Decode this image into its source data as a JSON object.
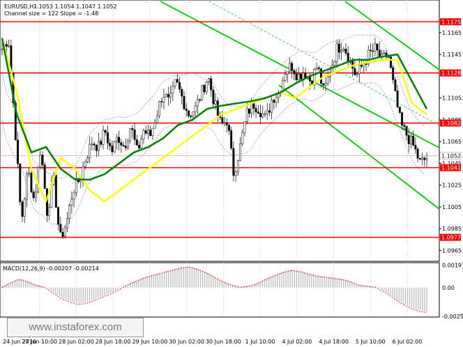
{
  "header": {
    "symbol": "EURUSD,H1",
    "ohlc": "1.1053 1.1054 1.1047 1.1052",
    "channel": "Channel size = 122 Slope = -1.48",
    "macd_label": "MACD(12,26,9) -0.00207 -0.00214"
  },
  "watermark": "www.instaforex.com",
  "chart_data": {
    "type": "line",
    "title": "EURUSD,H1",
    "ylim": [
      1.0955,
      1.1195
    ],
    "y_ticks": [
      "1.1165",
      "1.1145",
      "1.1105",
      "1.1085",
      "1.1065",
      "1.1045",
      "1.1025",
      "1.1005",
      "1.0985",
      "1.0965"
    ],
    "x_labels": [
      "24 Jun 2016",
      "27 Jun 10:00",
      "28 Jun 02:00",
      "28 Jun 18:00",
      "29 Jun 10:00",
      "30 Jun 02:00",
      "30 Jun 18:00",
      "1 Jul 10:00",
      "4 Jul 02:00",
      "4 Jul 18:00",
      "5 Jul 10:00",
      "6 Jul 02:00"
    ],
    "horizontal_levels": [
      1.1175,
      1.1128,
      1.1082,
      1.1041,
      1.0977
    ],
    "current_price": 1.1052,
    "price_anchors": [
      1.115,
      1.116,
      1.108,
      1.099,
      1.104,
      1.101,
      1.106,
      1.1,
      1.103,
      1.0975,
      1.099,
      1.102,
      1.103,
      1.105,
      1.1065,
      1.106,
      1.1075,
      1.1055,
      1.107,
      1.106,
      1.108,
      1.1055,
      1.1075,
      1.107,
      1.109,
      1.111,
      1.11,
      1.112,
      1.1105,
      1.109,
      1.1095,
      1.111,
      1.1125,
      1.11,
      1.108,
      1.1085,
      1.1035,
      1.106,
      1.109,
      1.11,
      1.1095,
      1.1085,
      1.1105,
      1.111,
      1.113,
      1.1135,
      1.1125,
      1.113,
      1.112,
      1.1135,
      1.111,
      1.113,
      1.115,
      1.1155,
      1.114,
      1.1125,
      1.1135,
      1.1145,
      1.115,
      1.114,
      1.1145,
      1.111,
      1.108,
      1.107,
      1.106,
      1.1045,
      1.105
    ],
    "ma_fast": [
      1.116,
      1.111,
      1.104,
      1.101,
      1.105,
      1.104,
      1.102,
      1.101,
      1.102,
      1.103,
      1.104,
      1.105,
      1.106,
      1.107,
      1.108,
      1.109,
      1.1095,
      1.11,
      1.1105,
      1.111,
      1.1105,
      1.1115,
      1.1125,
      1.113,
      1.1135,
      1.1138,
      1.114,
      1.114,
      1.11,
      1.109
    ],
    "ma_slow": [
      1.116,
      1.109,
      1.1055,
      1.106,
      1.104,
      1.103,
      1.103,
      1.1035,
      1.1045,
      1.1055,
      1.106,
      1.1068,
      1.108,
      1.1085,
      1.1095,
      1.1098,
      1.11,
      1.1102,
      1.1105,
      1.111,
      1.1118,
      1.1125,
      1.113,
      1.1135,
      1.114,
      1.114,
      1.1143,
      1.1145,
      1.112,
      1.1095
    ],
    "ma_fast_color": "#ffff00",
    "ma_slow_color": "#008000",
    "level_color": "#ff0000",
    "channel_color": "#00cc00",
    "macd_series": [
      0.0001,
      0.0005,
      0.0008,
      0.0006,
      0.0003,
      0.0001,
      -0.0004,
      -0.0009,
      -0.0012,
      -0.0014,
      -0.0013,
      -0.001,
      -0.0007,
      -0.0004,
      0.0,
      0.0004,
      0.0007,
      0.001,
      0.0012,
      0.0014,
      0.0016,
      0.0018,
      0.0019,
      0.0017,
      0.0014,
      0.001,
      0.0006,
      0.0003,
      0.0001,
      0.0002,
      0.0004,
      0.0008,
      0.0011,
      0.0014,
      0.0016,
      0.0015,
      0.0013,
      0.0011,
      0.001,
      0.0009,
      0.0008,
      0.0006,
      0.0003,
      0.0002,
      0.0001,
      -0.0003,
      -0.0008,
      -0.0013,
      -0.0017,
      -0.002,
      -0.0021
    ],
    "macd_ticks": [
      "0.00197",
      "0.00",
      "-0.00254"
    ],
    "macd_ylim": [
      -0.0026,
      0.0022
    ]
  }
}
